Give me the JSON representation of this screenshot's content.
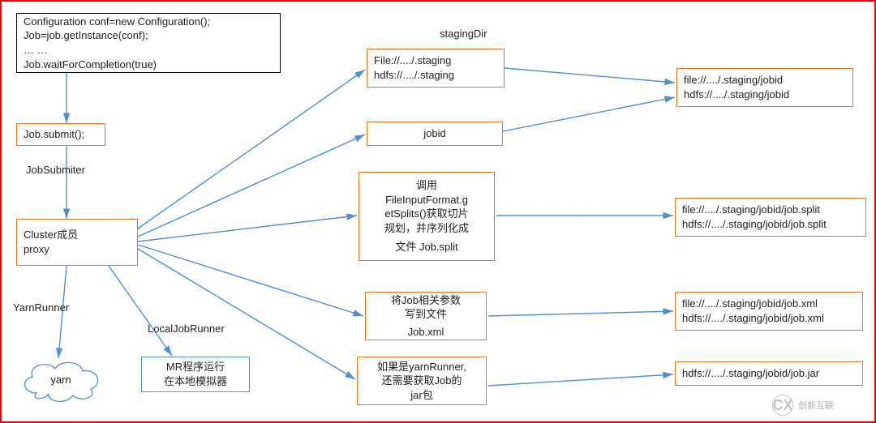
{
  "labels": {
    "jobSubmiter": "JobSubmiter",
    "yarnRunner": "YarnRunner",
    "localJobRunner": "LocalJobRunner",
    "stagingDir": "stagingDir",
    "watermark": "创新互联"
  },
  "boxes": {
    "config": {
      "line1": "Configuration conf=new Configuration();",
      "line2": "Job=job.getInstance(conf);",
      "line3": "… …",
      "line4": "Job.waitForCompletion(true)"
    },
    "submit": {
      "text": "Job.submit();"
    },
    "cluster": {
      "line1": "Cluster成员",
      "line2": "proxy"
    },
    "mrLocal": {
      "line1": "MR程序运行",
      "line2": "在本地模拟器"
    },
    "yarn": {
      "text": "yarn"
    },
    "stagingDir": {
      "line1": "File://..../.staging",
      "line2": "hdfs://..../.staging"
    },
    "jobid": {
      "text": "jobid"
    },
    "splits": {
      "line1": "调用",
      "line2": "FileInputFormat.g",
      "line3": "etSplits()获取切片",
      "line4": "规划，并序列化成",
      "line5": "文件  Job.split"
    },
    "jobxml": {
      "line1": "将Job相关参数",
      "line2": "写到文件",
      "line3": "Job.xml"
    },
    "jar": {
      "line1": "如果是yarnRunner,",
      "line2": "还需要获取Job的",
      "line3": "jar包"
    },
    "jobidPath": {
      "line1": "file://..../.staging/jobid",
      "line2": "hdfs://..../.staging/jobid"
    },
    "splitPath": {
      "line1": "file://..../.staging/jobid/job.split",
      "line2": "hdfs://..../.staging/jobid/job.split"
    },
    "xmlPath": {
      "line1": "file://..../.staging/jobid/job.xml",
      "line2": "hdfs://..../.staging/jobid/job.xml"
    },
    "jarPath": {
      "line1": "hdfs://..../.staging/jobid/job.jar"
    }
  }
}
